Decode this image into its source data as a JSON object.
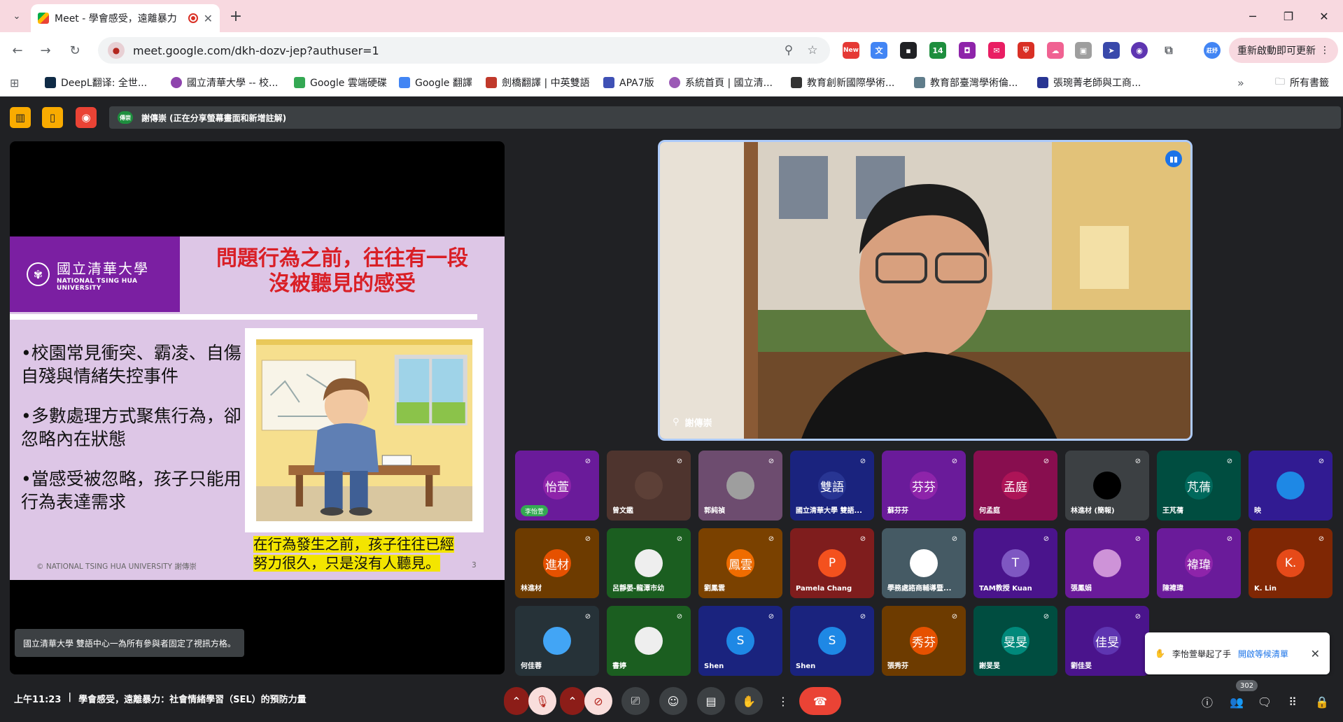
{
  "browser": {
    "tab_title": "Meet - 學會感受，遠離暴力",
    "tab_close": "✕",
    "new_tab": "+",
    "url": "meet.google.com/dkh-dozv-jep?authuser=1",
    "update_label": "重新啟動即可更新",
    "ext_badge_new": "New",
    "ext_badge_count": "14",
    "profile_label": "莊妤",
    "window": {
      "minimize": "─",
      "restore": "❐",
      "close": "✕"
    },
    "bookmarks": [
      {
        "label": "DeepL翻译: 全世...",
        "color": "#0f2b46"
      },
      {
        "label": "國立清華大學 -- 校...",
        "color": "#8e44ad"
      },
      {
        "label": "Google 雲端硬碟",
        "color": "#34a853"
      },
      {
        "label": "Google 翻譯",
        "color": "#4285f4"
      },
      {
        "label": "劍橋翻譯 | 中英雙語",
        "color": "#c0392b"
      },
      {
        "label": "APA7版",
        "color": "#3f51b5"
      },
      {
        "label": "系統首頁 | 國立清...",
        "color": "#9b59b6"
      },
      {
        "label": "教育創新國際學術...",
        "color": "#333333"
      },
      {
        "label": "教育部臺灣學術倫...",
        "color": "#607d8b"
      },
      {
        "label": "張琬菁老師與工商...",
        "color": "#283593"
      }
    ],
    "bookmarks_more": "»",
    "all_bookmarks": "所有書籤"
  },
  "meet": {
    "presenter_banner": "謝傳崇 (正在分享螢幕畫面和新增註解)",
    "presenter_badge": "傳崇",
    "pin_notice": "國立清華大學 雙語中心一為所有參與者固定了視訊方格。",
    "time": "上午11:23",
    "separator": "|",
    "meeting_title": "學會感受，遠離暴力：社會情緒學習（SEL）的預防力量",
    "people_count": "302",
    "speaker_name": "謝傳崇",
    "hand_toast": {
      "text": "李怡萱舉起了手",
      "link": "開啟等候清單"
    }
  },
  "slide": {
    "uni_zh": "國立清華大學",
    "uni_en": "NATIONAL TSING HUA UNIVERSITY",
    "title_line1": "問題行為之前，往往有一段",
    "title_line2": "沒被聽見的感受",
    "bullet1": "•校園常見衝突、霸凌、自傷自殘與情緒失控事件",
    "bullet2": "•多數處理方式聚焦行為，卻忽略內在狀態",
    "bullet3": "•當感受被忽略，孩子只能用行為表達需求",
    "caption_line1": "在行為發生之前，孩子往往已經",
    "caption_line2": "努力很久，只是沒有人聽見。",
    "footer": "© NATIONAL TSING HUA UNIVERSITY  謝傳崇",
    "page": "3"
  },
  "participants": [
    {
      "name": "李怡萱",
      "avatar": "怡萱",
      "color": "#8e24aa",
      "bg": "#6a1b9a",
      "hand": true
    },
    {
      "name": "曾文鑑",
      "avatar": "",
      "color": "#5d4037",
      "bg": "#4e342e"
    },
    {
      "name": "郭純禎",
      "avatar": "",
      "color": "#9e9e9e",
      "bg": "#6d4c6f"
    },
    {
      "name": "國立清華大學 雙語...",
      "avatar": "雙語",
      "color": "#283593",
      "bg": "#1a237e"
    },
    {
      "name": "蘇芬芬",
      "avatar": "芬芬",
      "color": "#8e24aa",
      "bg": "#6a1b9a"
    },
    {
      "name": "何孟庭",
      "avatar": "孟庭",
      "color": "#ad1457",
      "bg": "#880e4f"
    },
    {
      "name": "林進材 (簡報)",
      "avatar": "",
      "color": "#000000",
      "bg": "#3c4043"
    },
    {
      "name": "王芃蒨",
      "avatar": "芃蒨",
      "color": "#00695c",
      "bg": "#004d40"
    },
    {
      "name": "映",
      "avatar": "",
      "color": "#1e88e5",
      "bg": "#311b92"
    },
    {
      "name": "林進材",
      "avatar": "進材",
      "color": "#e65100",
      "bg": "#6d3b00"
    },
    {
      "name": "呂靜晏-龍潭市幼",
      "avatar": "",
      "color": "#eeeeee",
      "bg": "#1b5e20"
    },
    {
      "name": "劉鳳雲",
      "avatar": "鳳雲",
      "color": "#ef6c00",
      "bg": "#7a4100"
    },
    {
      "name": "Pamela Chang",
      "avatar": "P",
      "color": "#f4511e",
      "bg": "#7f1d1d"
    },
    {
      "name": "學務處諮商輔導暨...",
      "avatar": "",
      "color": "#ffffff",
      "bg": "#455a64"
    },
    {
      "name": "TAM教授 Kuan",
      "avatar": "T",
      "color": "#7e57c2",
      "bg": "#4a148c"
    },
    {
      "name": "張鳳娟",
      "avatar": "",
      "color": "#ce93d8",
      "bg": "#6a1b9a"
    },
    {
      "name": "陳褘瑋",
      "avatar": "褘瑋",
      "color": "#8e24aa",
      "bg": "#6a1b9a"
    },
    {
      "name": "K. Lin",
      "avatar": "K.",
      "color": "#e64a19",
      "bg": "#7f2704"
    },
    {
      "name": "何佳蓉",
      "avatar": "",
      "color": "#42a5f5",
      "bg": "#263238"
    },
    {
      "name": "書婷",
      "avatar": "",
      "color": "#eeeeee",
      "bg": "#1b5e20"
    },
    {
      "name": "Shen",
      "avatar": "S",
      "color": "#1e88e5",
      "bg": "#1a237e"
    },
    {
      "name": "Shen",
      "avatar": "S",
      "color": "#1e88e5",
      "bg": "#1a237e"
    },
    {
      "name": "張秀芬",
      "avatar": "秀芬",
      "color": "#e65100",
      "bg": "#6d3b00"
    },
    {
      "name": "謝旻旻",
      "avatar": "旻旻",
      "color": "#00897b",
      "bg": "#004d40"
    },
    {
      "name": "劉佳旻",
      "avatar": "佳旻",
      "color": "#5e35b1",
      "bg": "#4a148c"
    }
  ],
  "colors": {
    "meet_bg": "#202124",
    "slide_purple": "#7b1fa2",
    "slide_title_red": "#d91f26",
    "highlight": "#f3e500",
    "leave_red": "#ea4335",
    "accent_blue": "#1a73e8"
  }
}
